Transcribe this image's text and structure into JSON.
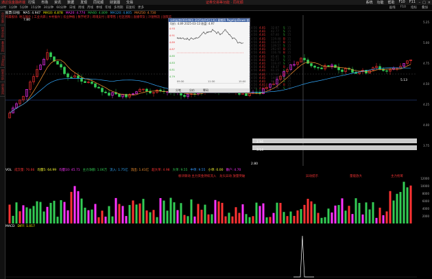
{
  "menu": {
    "logo": "通达信金融终端",
    "items": [
      "行情",
      "市场",
      "资讯",
      "数据",
      "发现",
      "同花顺",
      "财富圈",
      "交易"
    ],
    "center": "证券交易等功能 · 同花顺",
    "right": [
      "系统",
      "功能",
      "帮助",
      "F10",
      "F11"
    ]
  },
  "toolbar": {
    "items": [
      "分时",
      "1分钟",
      "5分钟",
      "15分钟",
      "30分钟",
      "60分钟",
      "日线",
      "周线",
      "月线",
      "季线",
      "年线",
      "多周期",
      "前复权",
      "更多"
    ],
    "right": [
      "画线",
      "F10",
      "指标",
      "叠加"
    ]
  },
  "left_tabs": [
    "分时走势",
    "技术分析",
    "基本资料",
    "F10资料",
    "财务分析",
    "资金流向"
  ],
  "info": {
    "stock": "股票(日线)",
    "ma": "MA5: 4.947",
    "ma10": "MA10: 4.878",
    "ma20": "MA20: 4.774",
    "ma60": "MA60: 4.809",
    "other1": "MA120: 4.805",
    "other2": "MA250: 4.730"
  },
  "notice": "所属板块: 地方国企 | 工业大麻 | 乡村振兴 | 农业种植 | 数字经济 | 跨境支付 | 新零售 | 社区团购 | 直播带货 | 冷链物流 | 国资云",
  "price_axis": [
    "5.25",
    "5.00",
    "4.75",
    "4.50",
    "4.25",
    "4.00",
    "3.75"
  ],
  "right_rail_values": [
    "3.50%",
    "2.88%",
    "1.75%",
    "0.29%",
    "0.00%",
    "-0.71%",
    "-1.47%",
    "-2.88%",
    "-3.50%"
  ],
  "chart_labels": {
    "high": "7.80",
    "low": "2.80",
    "mark1": "2.94",
    "mark2": "3.14",
    "last": "5.13"
  },
  "popup": {
    "title": "分时走势(002460) 2025年03月13日 星期四  PageUp/Down:前后日  空格键:操作",
    "sub": "均价: 4.89  2025-03-13 收盘: 4.97",
    "times": [
      "09:30",
      "11:30",
      "15:00"
    ],
    "left_axis": [
      "4.93",
      "4.91",
      "4.89",
      "4.87",
      "4.85",
      "4.83",
      "4.81",
      "4.79"
    ],
    "tabs": [
      "分笔",
      "分价",
      "筹码"
    ],
    "ticks": [
      {
        "t": "14:56",
        "p": "4.81",
        "v": "32.67",
        "b": "S",
        "n": "15"
      },
      {
        "t": "14:56",
        "p": "4.81",
        "v": "42.77",
        "b": "S",
        "n": "15"
      },
      {
        "t": "14:56",
        "p": "4.81",
        "v": "67.40",
        "b": "S",
        "n": "15"
      },
      {
        "t": "14:56",
        "p": "4.81",
        "v": "119.48",
        "b": "B",
        "n": "15"
      },
      {
        "t": "14:56",
        "p": "4.81",
        "v": "114.47",
        "b": "B",
        "n": "15"
      },
      {
        "t": "14:56",
        "p": "4.81",
        "v": "139.57",
        "b": "S",
        "n": "15"
      },
      {
        "t": "14:56",
        "p": "4.81",
        "v": "292.97",
        "b": "B",
        "n": "15"
      },
      {
        "t": "14:56",
        "p": "4.81",
        "v": "116.78",
        "b": "B",
        "n": "15"
      },
      {
        "t": "14:56",
        "p": "4.81",
        "v": "85.81",
        "b": "S",
        "n": "15"
      },
      {
        "t": "14:56",
        "p": "4.81",
        "v": "62.77",
        "b": "S",
        "n": "15"
      },
      {
        "t": "14:56",
        "p": "4.81",
        "v": "119.47",
        "b": "S",
        "n": "15"
      },
      {
        "t": "14:56",
        "p": "4.81",
        "v": "48.37",
        "b": "B",
        "n": "15"
      },
      {
        "t": "14:56",
        "p": "4.81",
        "v": "61.15",
        "b": "S",
        "n": "15"
      },
      {
        "t": "14:56",
        "p": "4.81",
        "v": "67.97",
        "b": "B",
        "n": "15"
      },
      {
        "t": "14:56",
        "p": "4.81",
        "v": "144.77",
        "b": "S",
        "n": "15"
      },
      {
        "t": "14:56",
        "p": "4.81",
        "v": "94.77",
        "b": "S",
        "n": "15"
      },
      {
        "t": "14:56",
        "p": "4.81",
        "v": "111.81",
        "b": "B",
        "n": "15"
      },
      {
        "t": "14:56",
        "p": "4.81",
        "v": "98.70",
        "b": "S",
        "n": "15"
      }
    ]
  },
  "volume": {
    "label": "VOL",
    "items": [
      "成交量: 70.66",
      "均量5: 64.99",
      "均量10: 45.71",
      "主力净额: 1.06万",
      "流入: 1.75亿",
      "流出: 1.41亿",
      "超大单: 4.98",
      "大单: 9.55",
      "中单: 9.55",
      "小单: 0.00",
      "散户: 4.70"
    ],
    "axis": [
      "12000",
      "10000",
      "8000",
      "6000",
      "4000",
      "2000"
    ]
  },
  "annotations": {
    "a1": "板块联动  主力资金持续流入",
    "a2": "龙头异动  放量突破",
    "a3": "异动提示",
    "a4": "量能放大",
    "a5": "主力抢筹"
  },
  "indicator2": {
    "label": "MACD",
    "value": "DIFF: 1.017"
  },
  "colors": {
    "up": "#ff3333",
    "down": "#33cc55",
    "magenta": "#ff33ff",
    "ma": "#33aaff",
    "bg": "#000000"
  }
}
